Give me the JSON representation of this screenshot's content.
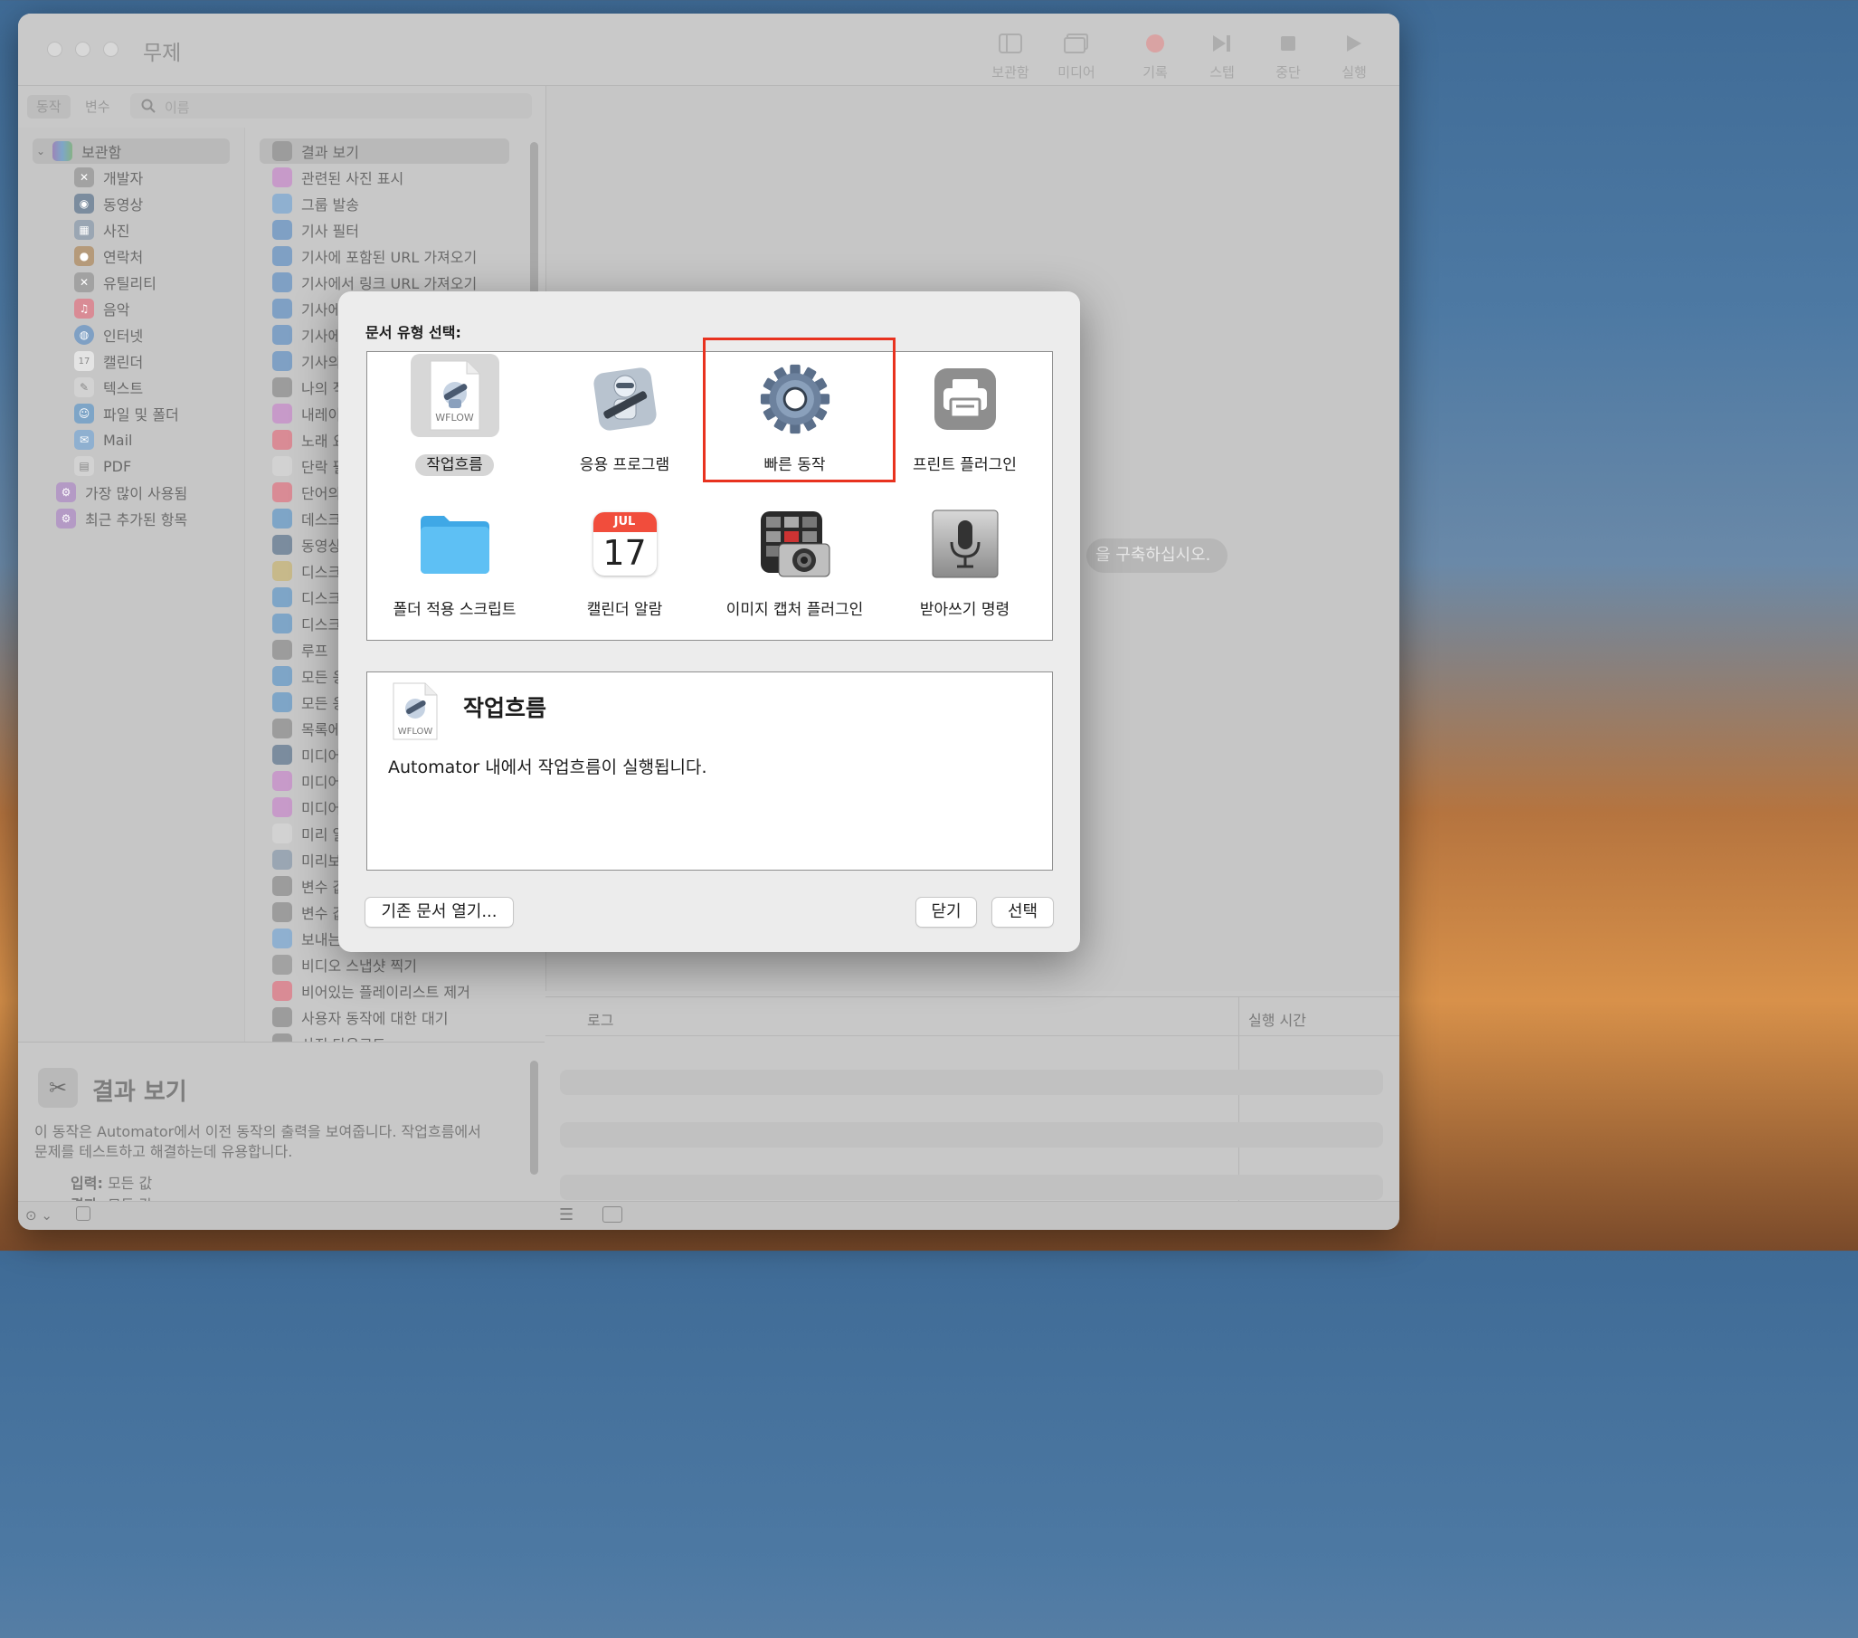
{
  "window": {
    "title": "무제"
  },
  "toolbar": [
    {
      "label": "보관함",
      "icon": "library-icon"
    },
    {
      "label": "미디어",
      "icon": "media-icon"
    },
    {
      "label": "기록",
      "icon": "record-icon"
    },
    {
      "label": "스텝",
      "icon": "step-icon"
    },
    {
      "label": "중단",
      "icon": "stop-icon"
    },
    {
      "label": "실행",
      "icon": "run-icon"
    }
  ],
  "tabs": {
    "actions": "동작",
    "variables": "변수",
    "search_placeholder": "이름"
  },
  "library": {
    "root": "보관함",
    "items": [
      "개발자",
      "동영상",
      "사진",
      "연락처",
      "유틸리티",
      "음악",
      "인터넷",
      "캘린더",
      "텍스트",
      "파일 및 폴더",
      "Mail",
      "PDF"
    ],
    "smart": [
      "가장 많이 사용됨",
      "최근 추가된 항목"
    ]
  },
  "actions": [
    "결과 보기",
    "관련된 사진 표시",
    "그룹 발송",
    "기사 필터",
    "기사에 포함된 URL 가져오기",
    "기사에서 링크 URL 가져오기",
    "기사에",
    "기사에",
    "기사의",
    "나의 직",
    "내레이",
    "노래 요",
    "단락 필",
    "단어의",
    "데스크",
    "동영상",
    "디스크",
    "디스크",
    "디스크",
    "루프",
    "모든 응",
    "모든 응",
    "목록에",
    "미디어",
    "미디어",
    "미디어",
    "미리 알",
    "미리보",
    "변수 값",
    "변수 값",
    "보내는",
    "비디오 스냅샷 찍기",
    "비어있는 플레이리스트 제거",
    "사용자 동작에 대한 대기",
    "사진 다운로드"
  ],
  "description": {
    "title": "결과 보기",
    "text": "이 동작은 Automator에서 이전 동작의 출력을 보여줍니다. 작업흐름에서 문제를 테스트하고 해결하는데 유용합니다.",
    "input_label": "입력:",
    "input_value": "모든 값",
    "result_label": "결과:",
    "result_value": "모든 값"
  },
  "main": {
    "hint": "을 구축하십시오."
  },
  "log": {
    "col_log": "로그",
    "col_time": "실행 시간"
  },
  "dialog": {
    "title": "문서 유형 선택:",
    "types": [
      {
        "label": "작업흐름",
        "icon": "workflow-icon"
      },
      {
        "label": "응용 프로그램",
        "icon": "application-icon"
      },
      {
        "label": "빠른 동작",
        "icon": "quick-action-gear-icon"
      },
      {
        "label": "프린트 플러그인",
        "icon": "print-plugin-icon"
      },
      {
        "label": "폴더 적용 스크립트",
        "icon": "folder-action-icon"
      },
      {
        "label": "캘린더 알람",
        "icon": "calendar-alarm-icon"
      },
      {
        "label": "이미지 캡처 플러그인",
        "icon": "image-capture-icon"
      },
      {
        "label": "받아쓰기 명령",
        "icon": "dictation-icon"
      }
    ],
    "calendar_month": "JUL",
    "calendar_day": "17",
    "wflow_tag": "WFLOW",
    "selected_type": "작업흐름",
    "detail_title": "작업흐름",
    "detail_text": "Automator 내에서 작업흐름이 실행됩니다.",
    "open_existing": "기존 문서 열기...",
    "close": "닫기",
    "choose": "선택"
  }
}
